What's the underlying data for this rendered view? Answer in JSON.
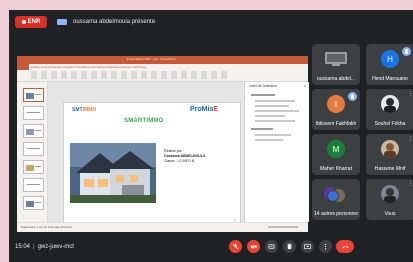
{
  "topbar": {
    "rec_label": "ENR",
    "presenter_label": "oussama abdelmoula présente"
  },
  "presentation": {
    "window_title": "Présentation PDF - ppt - PowerPoint",
    "ribbon_tabs": "Fichier  Accueil  Insertion  Création  Transitions  Animations  Diaporama  Révision  Affichage",
    "slide": {
      "logo_left": "SMT",
      "logo_left_accent": "IMMO",
      "center_title": "SMARTIMMO",
      "logo_right": "ProMis",
      "logo_right_accent": "E",
      "realise_label": "Réalisé par :",
      "author": "Oussama ABDELMOULA",
      "class_label": "Classe : L2 INFO B",
      "page_number": "1"
    },
    "side_pane_title": "Volet de Sélection",
    "status_text": "Diapositive 1 sur 12   Français (France)"
  },
  "participants": [
    {
      "name": "oussama abdel...",
      "initial": "",
      "type": "screen"
    },
    {
      "name": "Hend Marouane",
      "initial": "H",
      "type": "avatar",
      "color": "#1a73e8"
    },
    {
      "name": "Ibtissem Fakhfakh",
      "initial": "I",
      "type": "avatar",
      "color": "#e37b40"
    },
    {
      "name": "Souhel Frikha",
      "initial": "",
      "type": "photo"
    },
    {
      "name": "Maher Kharrat",
      "initial": "M",
      "type": "avatar",
      "color": "#188038"
    },
    {
      "name": "Hassene Mnif",
      "initial": "",
      "type": "photo"
    },
    {
      "name": "14 autres personnes",
      "initial": "",
      "type": "stack"
    },
    {
      "name": "Vous",
      "initial": "",
      "type": "photo"
    }
  ],
  "bottombar": {
    "time": "15:04",
    "meeting_code": "gwz-juwv-mct"
  },
  "colors": {
    "record_red": "#d93025",
    "meet_bg": "#202124",
    "tile_bg": "#3c4043",
    "accent_blue": "#8ab4f8",
    "powerpoint_orange": "#c55a3a"
  }
}
